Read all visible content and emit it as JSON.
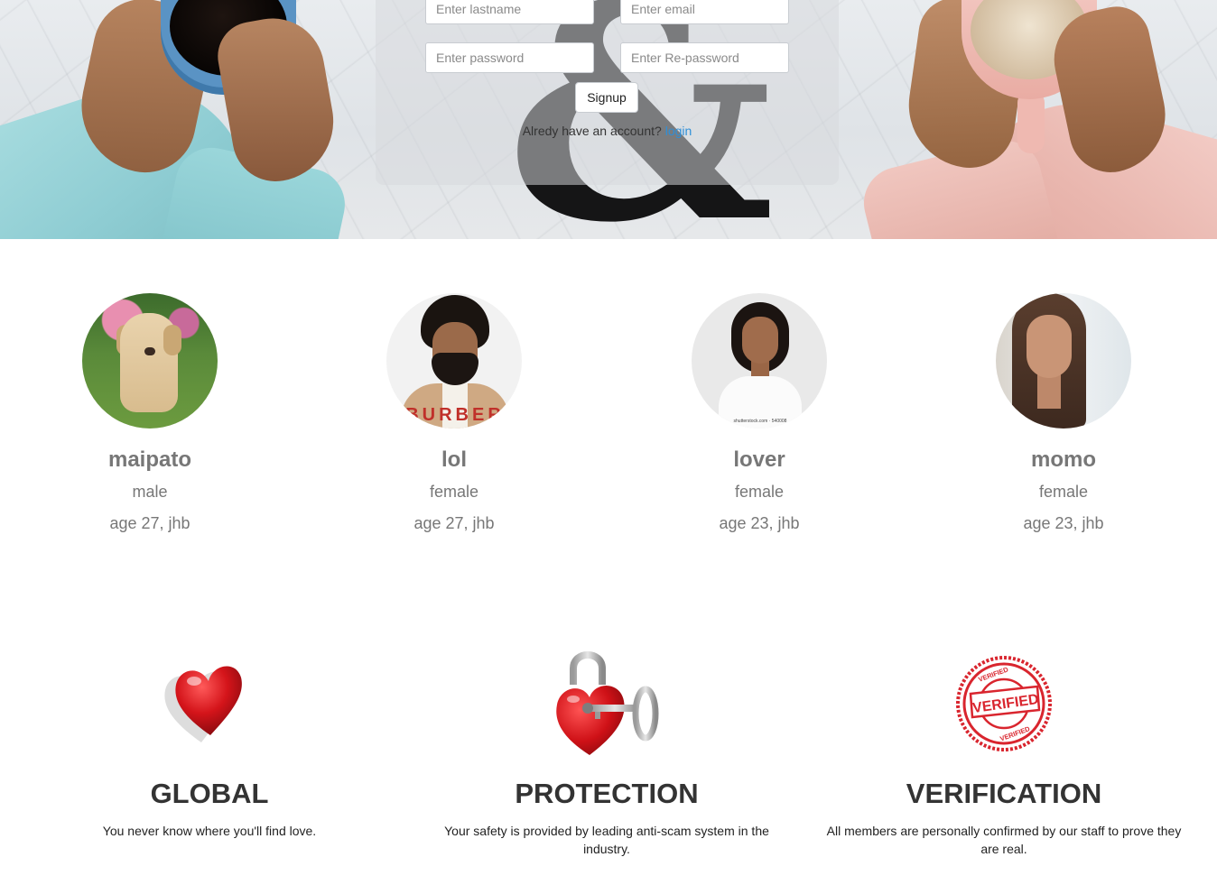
{
  "signup": {
    "lastname_placeholder": "Enter lastname",
    "email_placeholder": "Enter email",
    "password_placeholder": "Enter password",
    "repassword_placeholder": "Enter Re-password",
    "signup_label": "Signup",
    "account_prompt": "Alredy have an account?",
    "login_label": "login"
  },
  "profiles": [
    {
      "name": "maipato",
      "gender": "male",
      "age": "age 27, jhb"
    },
    {
      "name": "lol",
      "gender": "female",
      "age": "age 27, jhb"
    },
    {
      "name": "lover",
      "gender": "female",
      "age": "age 23, jhb"
    },
    {
      "name": "momo",
      "gender": "female",
      "age": "age 23, jhb"
    }
  ],
  "features": [
    {
      "icon": "heart-icon",
      "title": "GLOBAL",
      "text": "You never know where you'll find love."
    },
    {
      "icon": "heart-lock-key-icon",
      "title": "PROTECTION",
      "text": "Your safety is provided by leading anti-scam system in the industry."
    },
    {
      "icon": "verified-stamp-icon",
      "title": "VERIFICATION",
      "text": "All members are personally confirmed by our staff to prove they are real."
    }
  ],
  "images": {
    "man_shirt_text": "BURBER",
    "stamp_word": "VERIFIED",
    "avatar_watermark": "shutterstock.com · 540008"
  },
  "colors": {
    "link": "#2e8fd8",
    "profile_text": "#777777",
    "heading": "#333333",
    "heart_red": "#d4141a"
  }
}
